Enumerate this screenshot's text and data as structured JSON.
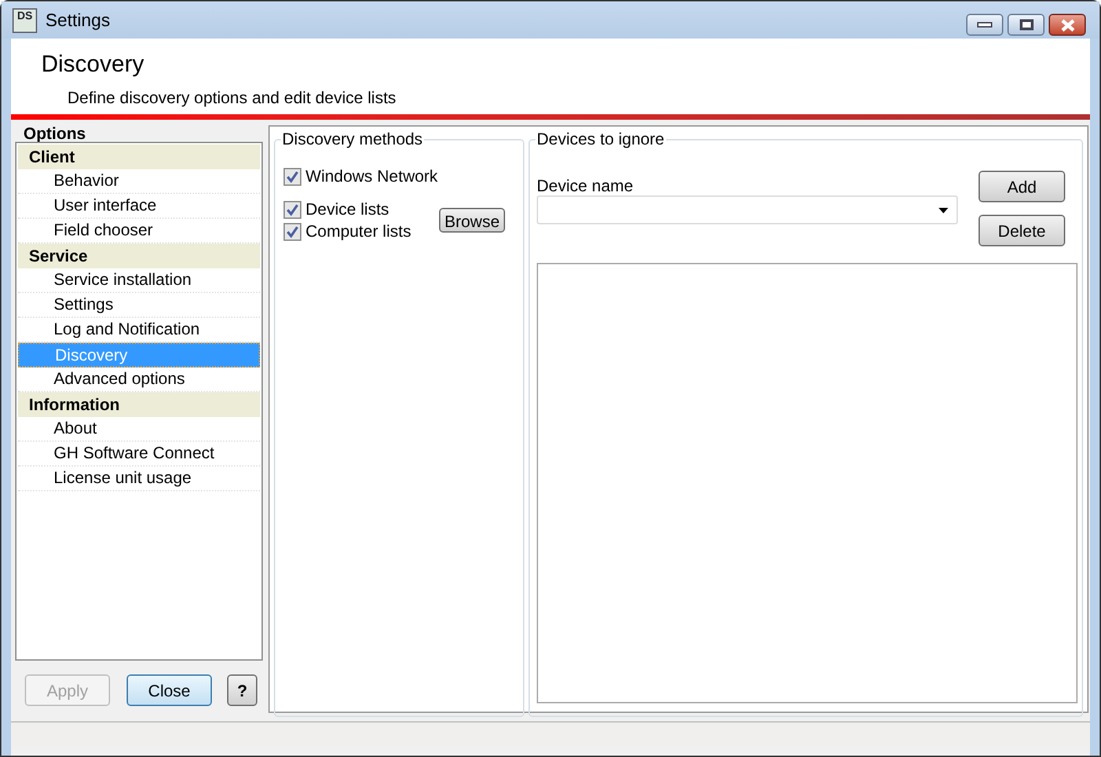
{
  "window": {
    "icon_text": "DS",
    "title": "Settings"
  },
  "header": {
    "title": "Discovery",
    "subtitle": "Define discovery options and edit device lists"
  },
  "sidebar": {
    "title": "Options",
    "groups": [
      {
        "label": "Client",
        "children": [
          {
            "label": "Behavior",
            "selected": false
          },
          {
            "label": "User interface",
            "selected": false
          },
          {
            "label": "Field chooser",
            "selected": false
          }
        ]
      },
      {
        "label": "Service",
        "children": [
          {
            "label": "Service installation",
            "selected": false
          },
          {
            "label": "Settings",
            "selected": false
          },
          {
            "label": "Log and Notification",
            "selected": false
          },
          {
            "label": "Discovery",
            "selected": true
          },
          {
            "label": "Advanced options",
            "selected": false
          }
        ]
      },
      {
        "label": "Information",
        "children": [
          {
            "label": "About",
            "selected": false
          },
          {
            "label": "GH Software Connect",
            "selected": false
          },
          {
            "label": "License unit usage",
            "selected": false
          }
        ]
      }
    ]
  },
  "buttons": [
    {
      "label": "Apply",
      "disabled": true
    },
    {
      "label": "Close",
      "disabled": false
    },
    {
      "label": "?",
      "disabled": false
    }
  ],
  "discovery_methods": {
    "title": "Discovery methods",
    "options": [
      {
        "label": "Windows Network",
        "checked": true
      },
      {
        "label": "Device lists",
        "checked": true
      },
      {
        "label": "Computer lists",
        "checked": true
      }
    ],
    "browse_button": "Browse"
  },
  "devices_to_ignore": {
    "title": "Devices to ignore",
    "field_label": "Device name",
    "add_button": "Add",
    "delete_button": "Delete"
  }
}
